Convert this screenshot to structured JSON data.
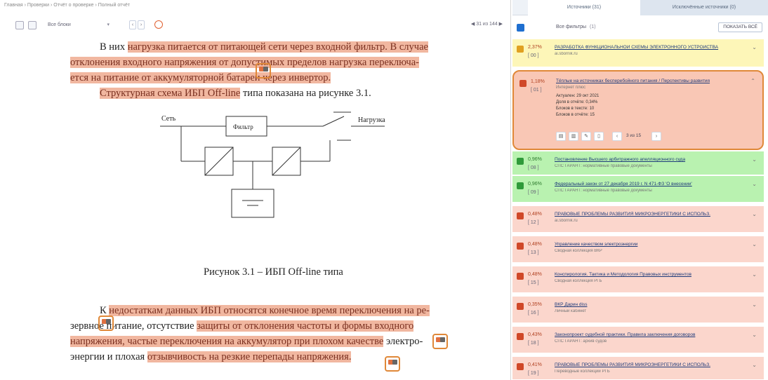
{
  "breadcrumb": "Главная › Проверки › Отчёт о проверке › Полный отчёт",
  "toolbar": {
    "mode_select": "Все блоки",
    "pager": "◀ 31 из 144 ▶"
  },
  "document": {
    "lines": [
      {
        "pre": "В них ",
        "hl": "нагрузка питается от питающей сети через входной фильтр. В случае",
        "post": ""
      },
      {
        "pre": "",
        "hl": "отклонения входного напряжения от допустимых пределов нагрузка переключа-",
        "post": ""
      },
      {
        "pre": "",
        "hl": "ется на питание от аккумуляторной батареи через инвертор.",
        "post": ""
      },
      {
        "pre": "",
        "hl": "Структурная схема ИБП Off-line",
        "post": " типа показана на рисунке 3.1."
      }
    ],
    "figure": {
      "label_net": "Сеть",
      "label_filter": "Фильтр",
      "label_load": "Нагрузка",
      "caption": "Рисунок 3.1 – ИБП Off-line типа"
    },
    "lines2": [
      {
        "pre": "К ",
        "hl": "недостаткам данных ИБП относятся конечное время переключения на ре-",
        "post": ""
      },
      {
        "pre": "зервное питание, отсутствие ",
        "hl": "защиты от отклонения частоты и формы входного",
        "post": ""
      },
      {
        "pre": "",
        "hl": "напряжения, частые переключения на аккумулятор при плохом качестве",
        "post": " электро-"
      },
      {
        "pre": "энергии и плохая ",
        "hl": "отзывчивость на резкие перепады напряжения.",
        "post": ""
      }
    ]
  },
  "right": {
    "tabs": [
      "Источники (31)",
      "Исключённые источники (0)"
    ],
    "filter_label": "Все фильтры",
    "filter_count": "(1)",
    "filter_button": "ПОКАЗАТЬ ВСЁ",
    "expanded": {
      "pct": "1,18%",
      "idx": "[ 01 ]",
      "title": "Тёплые на источниках бесперебойного питания / Перспективы развития",
      "subtitle": "Интернет плюс",
      "meta": [
        "Актуален: 29 окт 2021",
        "Доля в отчёте: 0,34%",
        "Блоков в тексте: 10",
        "Блоков в отчёте: 15"
      ],
      "pages": "3 из 15"
    },
    "sources": [
      {
        "cls": "y",
        "pct": "2,37%",
        "idx": "[ 00 ]",
        "title": "РАЗРАБОТКА ФУНКЦИОНАЛЬНОЙ СХЕМЫ ЭЛЕКТРОННОГО УСТРОЙСТВА",
        "sub": "ai.sbornik.ru"
      },
      {
        "cls": "g",
        "pct": "0,96%",
        "idx": "[ 08 ]",
        "title": "Постановление Высшего арбитражного апелляционного суда",
        "sub": "СПС ГАРАНТ: нормативные правовые документы"
      },
      {
        "cls": "g",
        "pct": "0,96%",
        "idx": "[ 09 ]",
        "title": "Федеральный закон от 27 декабря 2019 г. N 471-ФЗ 'О внесении'",
        "sub": "СПС ГАРАНТ: нормативные правовые документы"
      },
      {
        "cls": "r",
        "pct": "0,48%",
        "idx": "[ 12 ]",
        "title": "ПРАВОВЫЕ ПРОБЛЕМЫ РАЗВИТИЯ МИКРОЭНЕРГЕТИКИ С ИСПОЛЬЗ.",
        "sub": "ai.sbornik.ru"
      },
      {
        "cls": "r",
        "pct": "0,48%",
        "idx": "[ 13 ]",
        "title": "Управление качеством электроэнергии",
        "sub": "Сводная коллекция ВКР"
      },
      {
        "cls": "r",
        "pct": "0,48%",
        "idx": "[ 15 ]",
        "title": "Конспирология. Тактика и Методология Правовых инструментов",
        "sub": "Сводная коллекция РГБ"
      },
      {
        "cls": "r",
        "pct": "0,35%",
        "idx": "[ 16 ]",
        "title": "ВКР Дарин diss",
        "sub": "Личный кабинет"
      },
      {
        "cls": "r",
        "pct": "0,43%",
        "idx": "[ 18 ]",
        "title": "Законопроект судебной практики. Правила заключения договоров",
        "sub": "СПС ГАРАНТ: архив судов"
      },
      {
        "cls": "r",
        "pct": "0,41%",
        "idx": "[ 19 ]",
        "title": "ПРАВОВЫЕ ПРОБЛЕМЫ РАЗВИТИЯ МИКРОЭНЕРГЕТИКИ С ИСПОЛЬЗ.",
        "sub": "Переводные коллекции РГБ"
      }
    ]
  }
}
